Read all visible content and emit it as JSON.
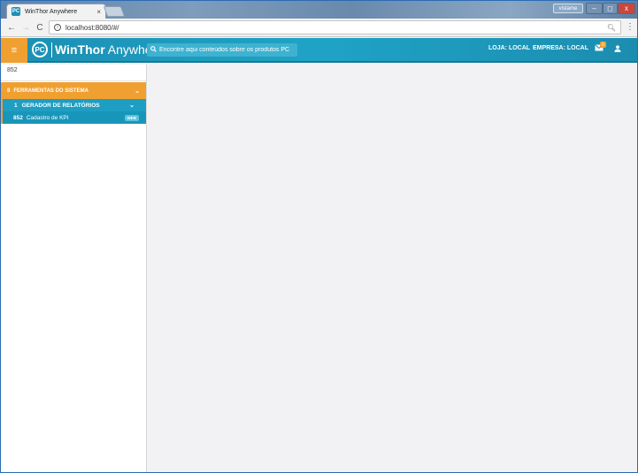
{
  "browser": {
    "tab_title": "WinThor Anywhere",
    "tab_close": "×",
    "user_name": "vistame",
    "url": "localhost:8080/#/",
    "window_min": "–",
    "window_max": "◻",
    "window_close": "x"
  },
  "header": {
    "menu_glyph": "≡",
    "logo_text": "PC",
    "brand_bold": "WinThor",
    "brand_light": " Anywhere",
    "search_placeholder": "Encontre aqui conteúdos sobre os produtos PC",
    "store_label": "LOJA: LOCAL",
    "company_label": "EMPRESA: LOCAL",
    "message_count": "0"
  },
  "sidebar": {
    "search_value": "852",
    "groups": [
      {
        "code": "8",
        "label": "FERRAMENTAS DO SISTEMA",
        "subgroups": [
          {
            "code": "1",
            "label": "GERADOR DE RELATÓRIOS",
            "items": [
              {
                "code": "852",
                "label": "Cadastro de KPI",
                "badge": "WEB"
              }
            ]
          }
        ]
      }
    ]
  },
  "colors": {
    "accent_orange": "#f0a030",
    "header_teal": "#1fa3c5",
    "submenu_teal": "#1e9ec2"
  }
}
